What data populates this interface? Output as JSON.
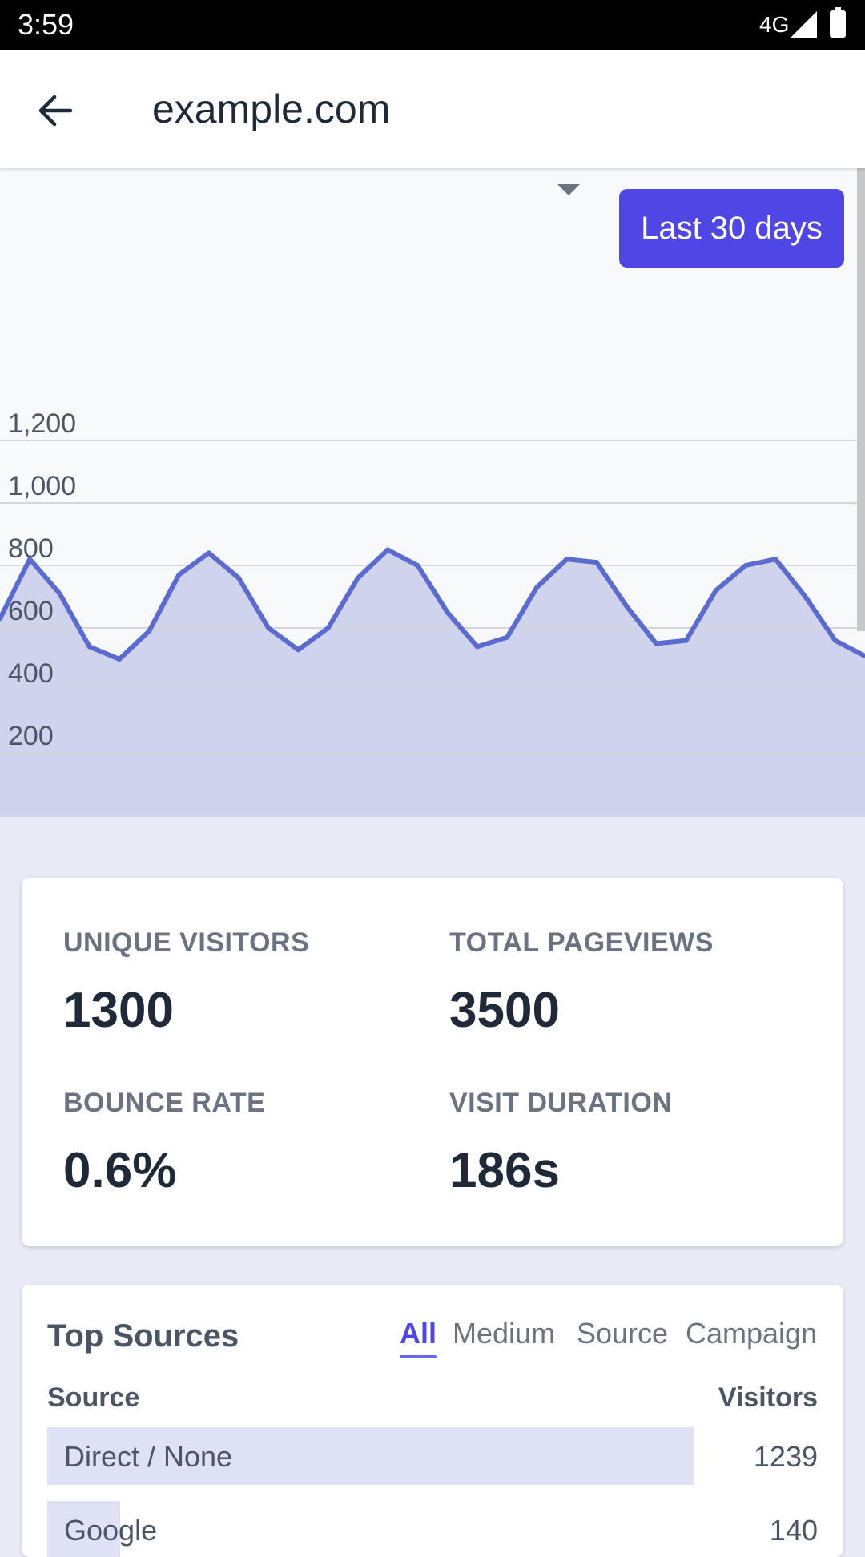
{
  "status_bar": {
    "time": "3:59",
    "network": "4G"
  },
  "app_bar": {
    "title": "example.com"
  },
  "date_range": {
    "label": "Last 30 days"
  },
  "chart_data": {
    "type": "area",
    "y_ticks": [
      "1,200",
      "1,000",
      "800",
      "600",
      "400",
      "200"
    ],
    "ylim": [
      0,
      1200
    ],
    "values": [
      630,
      820,
      710,
      540,
      500,
      590,
      770,
      840,
      760,
      600,
      530,
      600,
      760,
      850,
      800,
      650,
      540,
      570,
      730,
      820,
      810,
      670,
      550,
      560,
      720,
      800,
      820,
      700,
      560,
      510
    ],
    "grid": true,
    "color": "#5c6bd0",
    "fill_color": "#cfd3ee"
  },
  "stats": [
    {
      "label": "UNIQUE VISITORS",
      "value": "1300"
    },
    {
      "label": "TOTAL PAGEVIEWS",
      "value": "3500"
    },
    {
      "label": "BOUNCE RATE",
      "value": "0.6%"
    },
    {
      "label": "VISIT DURATION",
      "value": "186s"
    }
  ],
  "top_sources": {
    "title": "Top Sources",
    "tabs": [
      "All",
      "Medium",
      "Source",
      "Campaign"
    ],
    "active_tab": "All",
    "columns": {
      "source": "Source",
      "visitors": "Visitors"
    },
    "rows": [
      {
        "label": "Direct / None",
        "value": "1239",
        "share": 1.0
      },
      {
        "label": "Google",
        "value": "140",
        "share": 0.113
      }
    ]
  }
}
